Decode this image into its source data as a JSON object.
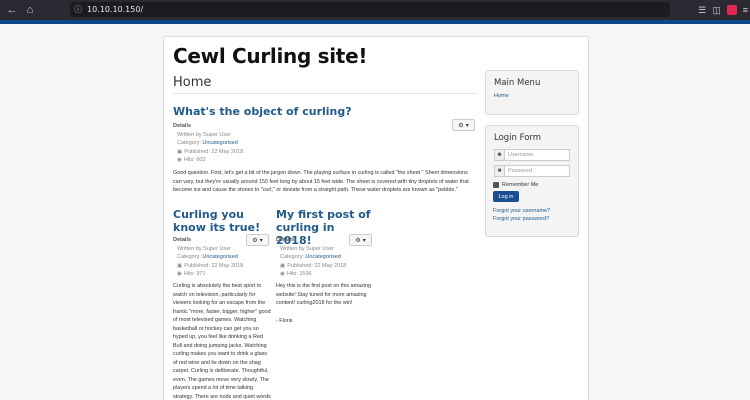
{
  "browser": {
    "url": "10.10.10.150/",
    "icons": [
      "back-icon",
      "home-icon",
      "library-icon",
      "sidebar-icon",
      "menu-icon"
    ]
  },
  "site": {
    "title": "Cewl Curling site!",
    "page_heading": "Home"
  },
  "articles": [
    {
      "title": "What's the object of curling?",
      "details_label": "Details",
      "written_by": "Written by Super User",
      "category_prefix": "Category: ",
      "category": "Uncategorised",
      "published": "Published: 22 May 2018",
      "hits": "Hits: 603",
      "body": "Good question. First, let's get a bit of the jargon down. The playing surface in curling is called \"the sheet.\" Sheet dimensions can vary, but they're usually around 150 feet long by about 15 feet wide. The sheet is covered with tiny droplets of water that become ice and cause the stones to \"curl,\" or deviate from a straight path. These water droplets are known as \"pebble.\""
    },
    {
      "title": "Curling you know its true!",
      "details_label": "Details",
      "written_by": "Written by Super User",
      "category_prefix": "Category: ",
      "category": "Uncategorised",
      "published": "Published: 22 May 2018",
      "hits": "Hits: 971",
      "body": "Curling is absolutely the best sport to watch on television, particularly for viewers looking for an escape from the frantic \"more, faster, bigger, higher\" good of most televised games. Watching basketball or hockey can get you so hyped up, you feel like drinking a Red Bull and doing jumping jacks. Watching curling makes you want to drink a glass of red wine and lie down on the shag carpet. Curling is deliberate. Thoughtful, even. The games move very slowly. The players spend a lot of time talking strategy. There are nods and quiet words of"
    },
    {
      "title": "My first post of curling in 2018!",
      "details_label": "Details",
      "written_by": "Written by Super User",
      "category_prefix": "Category: ",
      "category": "Uncategorised",
      "published": "Published: 22 May 2018",
      "hits": "Hits: 1596",
      "body": "Hey this is the first post on this amazing website! Stay tuned for more amazing content! curling2018 for the win!",
      "signoff": "- Floris"
    }
  ],
  "sidebar": {
    "main_menu": {
      "title": "Main Menu",
      "items": [
        "Home"
      ]
    },
    "login": {
      "title": "Login Form",
      "username_placeholder": "Username",
      "password_placeholder": "Password",
      "remember_label": "Remember Me",
      "button_label": "Log in",
      "forgot_username": "Forgot your username?",
      "forgot_password": "Forgot your password?"
    }
  }
}
